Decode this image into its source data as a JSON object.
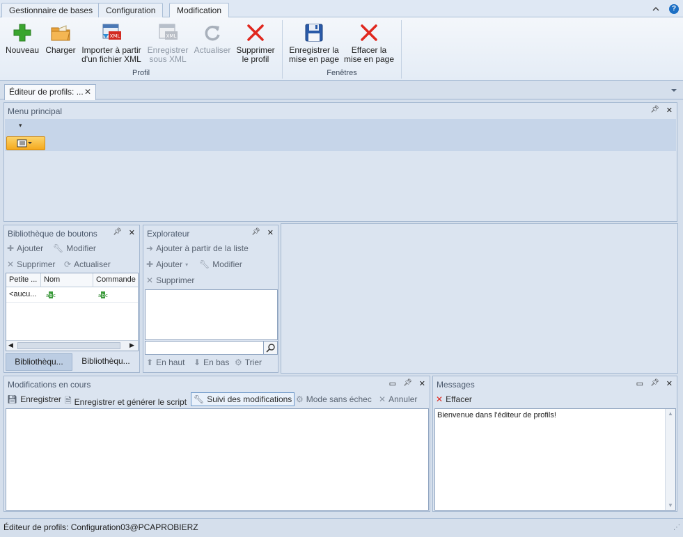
{
  "ribbon_tabs": [
    {
      "label": "Gestionnaire de bases",
      "active": false
    },
    {
      "label": "Configuration",
      "active": false
    },
    {
      "label": "Modification",
      "active": true
    }
  ],
  "ribbon": {
    "groups": [
      {
        "label": "Profil"
      },
      {
        "label": "Fenêtres"
      }
    ],
    "buttons": [
      {
        "line1": "Nouveau",
        "line2": "",
        "icon": "plus-icon",
        "enabled": true
      },
      {
        "line1": "Charger",
        "line2": "",
        "icon": "folder-open-icon",
        "enabled": true
      },
      {
        "line1": "Importer à partir",
        "line2": "d'un fichier XML",
        "icon": "import-xml-icon",
        "enabled": true
      },
      {
        "line1": "Enregistrer",
        "line2": "sous XML",
        "icon": "save-xml-icon",
        "enabled": false
      },
      {
        "line1": "Actualiser",
        "line2": "",
        "icon": "refresh-icon",
        "enabled": false
      },
      {
        "line1": "Supprimer",
        "line2": "le profil",
        "icon": "delete-x-icon",
        "enabled": true
      },
      {
        "line1": "Enregistrer la",
        "line2": "mise en page",
        "icon": "floppy-disk-icon",
        "enabled": true
      },
      {
        "line1": "Effacer la",
        "line2": "mise en page",
        "icon": "delete-x-icon",
        "enabled": true
      }
    ]
  },
  "doc_tab": {
    "label": "Éditeur de profils: ..."
  },
  "menu_principal": {
    "title": "Menu principal"
  },
  "bibliotheque": {
    "title": "Bibliothèque de boutons",
    "toolbar": [
      "Ajouter",
      "Modifier",
      "Supprimer",
      "Actualiser"
    ],
    "columns": [
      "Petite ...",
      "Nom",
      "Commande"
    ],
    "rows": [
      {
        "petite": "<aucu..."
      }
    ],
    "bottom_tabs": [
      "Bibliothèqu...",
      "Bibliothèqu..."
    ]
  },
  "explorateur": {
    "title": "Explorateur",
    "toolbar": [
      "Ajouter à partir de la liste",
      "Ajouter",
      "Modifier",
      "Supprimer"
    ],
    "search_value": "",
    "bottom": [
      "En haut",
      "En bas",
      "Trier"
    ]
  },
  "modifications": {
    "title": "Modifications en cours",
    "toolbar": [
      "Enregistrer",
      "Enregistrer et générer le script",
      "Suivi des modifications",
      "Mode sans échec",
      "Annuler"
    ]
  },
  "messages": {
    "title": "Messages",
    "toolbar": [
      "Effacer"
    ],
    "text": "Bienvenue dans l'éditeur de profils!"
  },
  "statusbar": {
    "text": "Éditeur de profils: Configuration03@PCAPROBIERZ"
  },
  "colors": {
    "accent_blue": "#1c6fc4",
    "delete_red": "#e0271e",
    "add_green": "#3aa52e",
    "orange_button": "#f7b52b"
  }
}
